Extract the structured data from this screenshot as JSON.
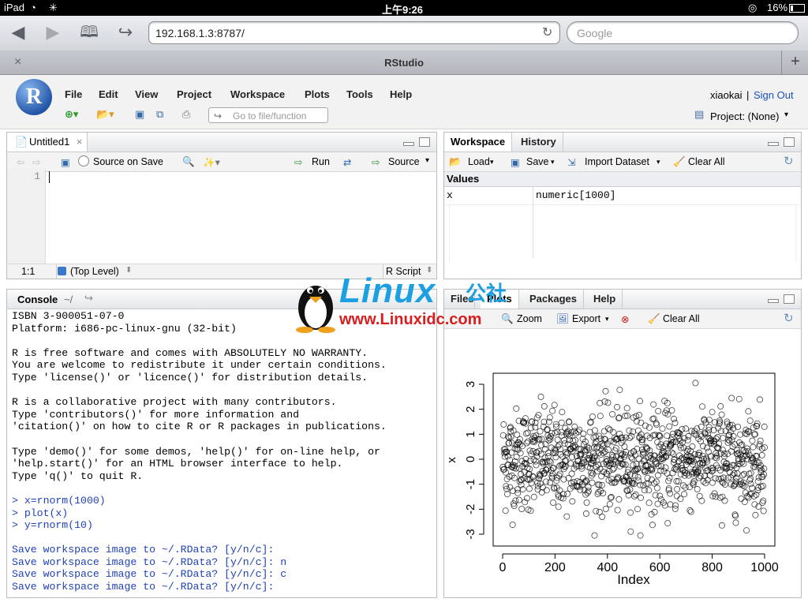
{
  "statusbar": {
    "device": "iPad",
    "time": "上午9:26",
    "battery": "16%"
  },
  "browser": {
    "url": "192.168.1.3:8787/",
    "search_placeholder": "Google",
    "tab_title": "RStudio",
    "close_tab": "×",
    "new_tab": "+"
  },
  "rstudio": {
    "menus": [
      "File",
      "Edit",
      "View",
      "Project",
      "Workspace",
      "Plots",
      "Tools",
      "Help"
    ],
    "user": "xiaokai",
    "sep": "|",
    "signout": "Sign Out",
    "goto_placeholder": "Go to file/function",
    "project": "Project: (None)"
  },
  "editor": {
    "tab": "Untitled1",
    "source_on_save": "Source on Save",
    "run": "Run",
    "source": "Source",
    "line_number": "1",
    "cursor_pos": "1:1",
    "scope": "(Top Level)",
    "filetype": "R Script"
  },
  "workspace": {
    "tabs": [
      "Workspace",
      "History"
    ],
    "load": "Load",
    "save": "Save",
    "import": "Import Dataset",
    "clear": "Clear All",
    "section": "Values",
    "rows": [
      {
        "name": "x",
        "value": "numeric[1000]"
      }
    ]
  },
  "console": {
    "title": "Console",
    "path": "~/",
    "lines": [
      {
        "t": "ISBN 3-900051-07-0",
        "c": "out"
      },
      {
        "t": "Platform: i686-pc-linux-gnu (32-bit)",
        "c": "out"
      },
      {
        "t": "",
        "c": "out"
      },
      {
        "t": "R is free software and comes with ABSOLUTELY NO WARRANTY.",
        "c": "out"
      },
      {
        "t": "You are welcome to redistribute it under certain conditions.",
        "c": "out"
      },
      {
        "t": "Type 'license()' or 'licence()' for distribution details.",
        "c": "out"
      },
      {
        "t": "",
        "c": "out"
      },
      {
        "t": "R is a collaborative project with many contributors.",
        "c": "out"
      },
      {
        "t": "Type 'contributors()' for more information and",
        "c": "out"
      },
      {
        "t": "'citation()' on how to cite R or R packages in publications.",
        "c": "out"
      },
      {
        "t": "",
        "c": "out"
      },
      {
        "t": "Type 'demo()' for some demos, 'help()' for on-line help, or",
        "c": "out"
      },
      {
        "t": "'help.start()' for an HTML browser interface to help.",
        "c": "out"
      },
      {
        "t": "Type 'q()' to quit R.",
        "c": "out"
      },
      {
        "t": "",
        "c": "out"
      },
      {
        "t": "> x=rnorm(1000)",
        "c": "in"
      },
      {
        "t": "> plot(x)",
        "c": "in"
      },
      {
        "t": "> y=rnorm(10)",
        "c": "in"
      },
      {
        "t": "",
        "c": "out"
      },
      {
        "t": "Save workspace image to ~/.RData? [y/n/c]:",
        "c": "in"
      },
      {
        "t": "Save workspace image to ~/.RData? [y/n/c]: n",
        "c": "in"
      },
      {
        "t": "Save workspace image to ~/.RData? [y/n/c]: c",
        "c": "in"
      },
      {
        "t": "Save workspace image to ~/.RData? [y/n/c]:",
        "c": "in"
      }
    ]
  },
  "plots": {
    "tabs": [
      "Files",
      "Plots",
      "Packages",
      "Help"
    ],
    "zoom": "Zoom",
    "export": "Export",
    "clear": "Clear All"
  },
  "watermark": {
    "big": "Linux",
    "cn": "公社",
    "url": "www.Linuxidc.com"
  },
  "chart_data": {
    "type": "scatter",
    "title": "",
    "xlabel": "Index",
    "ylabel": "x",
    "xlim": [
      0,
      1000
    ],
    "ylim": [
      -3,
      3
    ],
    "xticks": [
      "0",
      "200",
      "400",
      "600",
      "800",
      "1000"
    ],
    "yticks": [
      "-3",
      "-2",
      "-1",
      "0",
      "1",
      "2",
      "3"
    ],
    "series": [
      {
        "note": "x = rnorm(1000) plotted against index 1..1000",
        "n": 1000
      }
    ]
  }
}
